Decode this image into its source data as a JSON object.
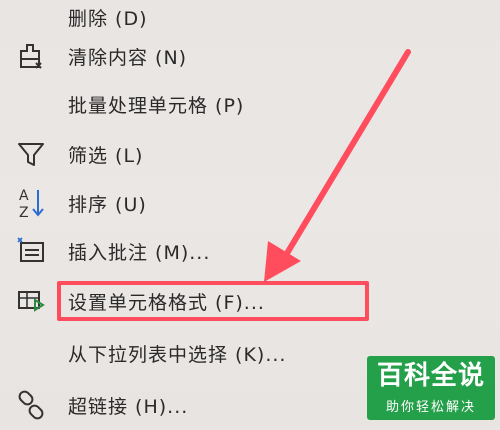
{
  "menu": {
    "items": [
      {
        "label": "删除 (D)",
        "icon": ""
      },
      {
        "label": "清除内容 (N)",
        "icon": "eraser-icon"
      },
      {
        "label": "批量处理单元格 (P)",
        "icon": ""
      },
      {
        "label": "筛选 (L)",
        "icon": "filter-icon"
      },
      {
        "label": "排序 (U)",
        "icon": "sort-az-icon"
      },
      {
        "label": "插入批注 (M)...",
        "icon": "insert-comment-icon"
      },
      {
        "label": "设置单元格格式 (F)...",
        "icon": "format-cells-icon"
      },
      {
        "label": "从下拉列表中选择 (K)...",
        "icon": ""
      },
      {
        "label": "超链接 (H)...",
        "icon": "link-icon"
      }
    ]
  },
  "highlight": {
    "target": "设置单元格格式 (F)...",
    "color": "#ff4d5e"
  },
  "watermark": {
    "title": "百科全说",
    "subtitle": "助你轻松解决",
    "color": "#24a04a"
  }
}
